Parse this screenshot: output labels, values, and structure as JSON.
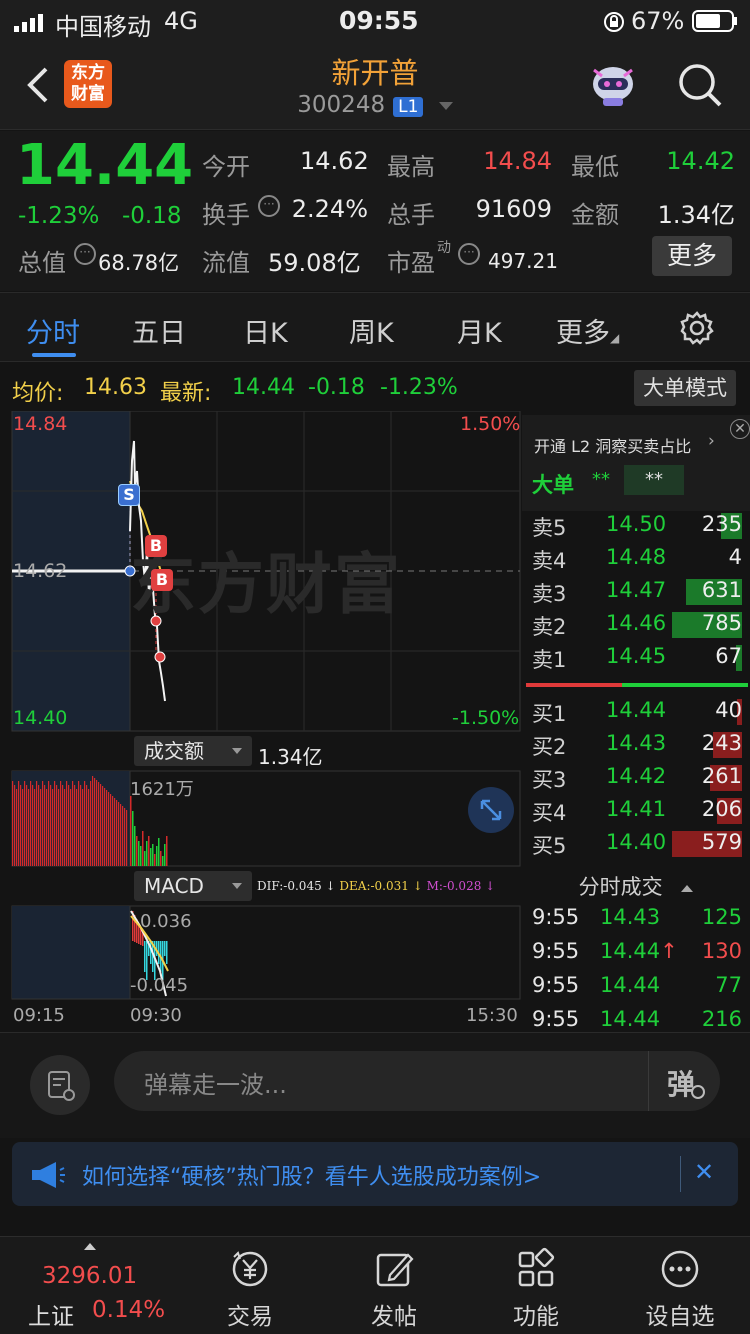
{
  "status_bar": {
    "carrier": "中国移动",
    "network": "4G",
    "time": "09:55",
    "battery": "67%"
  },
  "header": {
    "title": "新开普",
    "code": "300248",
    "level_badge": "L1",
    "logo_line1": "东方",
    "logo_line2": "财富"
  },
  "quote": {
    "price": "14.44",
    "change_pct": "-1.23%",
    "change": "-0.18",
    "open_label": "今开",
    "open": "14.62",
    "high_label": "最高",
    "high": "14.84",
    "low_label": "最低",
    "low": "14.42",
    "turnover_label": "换手",
    "turnover": "2.24%",
    "volume_label": "总手",
    "volume": "91609",
    "amount_label": "金额",
    "amount": "1.34亿",
    "mcap_label": "总值",
    "mcap": "68.78亿",
    "float_label": "流值",
    "float": "59.08亿",
    "pe_label": "市盈",
    "pe_sup": "动",
    "pe": "497.21",
    "more_button": "更多"
  },
  "tabs": [
    {
      "label": "分时",
      "active": true
    },
    {
      "label": "五日"
    },
    {
      "label": "日K"
    },
    {
      "label": "周K"
    },
    {
      "label": "月K"
    },
    {
      "label": "更多"
    }
  ],
  "info": {
    "avg_label": "均价:",
    "avg": "14.63",
    "latest_label": "最新:",
    "latest": "14.44",
    "latest_chg": "-0.18",
    "latest_pct": "-1.23%",
    "big_order_button": "大单模式"
  },
  "chart": {
    "price_top": "14.84",
    "price_mid": "14.62",
    "price_bottom": "14.40",
    "pct_top": "1.50%",
    "pct_bottom": "-1.50%",
    "watermark": "东方财富",
    "volume_selector": "成交额",
    "volume_total": "1.34亿",
    "volume_max": "1621万",
    "macd_selector": "MACD",
    "dif": "DIF:-0.045",
    "dea": "DEA:-0.031",
    "m": "M:-0.028",
    "macd_top": "0.036",
    "macd_bottom": "-0.045",
    "time_start": "09:15",
    "time_open": "09:30",
    "time_end": "15:30",
    "markers": [
      "S",
      "B",
      "B"
    ]
  },
  "side_panel": {
    "promo": "开通 L2 洞察买卖占比",
    "big_order_label": "大单",
    "big_order_val1": "**",
    "big_order_val2": "**",
    "asks": [
      {
        "label": "卖5",
        "price": "14.50",
        "vol": "235",
        "ratio": 0.3
      },
      {
        "label": "卖4",
        "price": "14.48",
        "vol": "4",
        "ratio": 0.0
      },
      {
        "label": "卖3",
        "price": "14.47",
        "vol": "631",
        "ratio": 0.8
      },
      {
        "label": "卖2",
        "price": "14.46",
        "vol": "785",
        "ratio": 1.0
      },
      {
        "label": "卖1",
        "price": "14.45",
        "vol": "67",
        "ratio": 0.09
      }
    ],
    "bids": [
      {
        "label": "买1",
        "price": "14.44",
        "vol": "40",
        "ratio": 0.07
      },
      {
        "label": "买2",
        "price": "14.43",
        "vol": "243",
        "ratio": 0.42
      },
      {
        "label": "买3",
        "price": "14.42",
        "vol": "261",
        "ratio": 0.45
      },
      {
        "label": "买4",
        "price": "14.41",
        "vol": "206",
        "ratio": 0.36
      },
      {
        "label": "买5",
        "price": "14.40",
        "vol": "579",
        "ratio": 1.0
      }
    ],
    "trades_title": "分时成交",
    "trades": [
      {
        "time": "9:55",
        "price": "14.43",
        "vol": "125",
        "vol_color": "#1fcf3a",
        "arrow": ""
      },
      {
        "time": "9:55",
        "price": "14.44",
        "vol": "130",
        "vol_color": "#f24d4d",
        "arrow": "↑"
      },
      {
        "time": "9:55",
        "price": "14.44",
        "vol": "77",
        "vol_color": "#1fcf3a",
        "arrow": ""
      },
      {
        "time": "9:55",
        "price": "14.44",
        "vol": "216",
        "vol_color": "#1fcf3a",
        "arrow": ""
      }
    ]
  },
  "danmu": {
    "placeholder": "弹幕走一波...",
    "send_label": "弹"
  },
  "banner": {
    "text": "如何选择“硬核”热门股？看牛人选股成功案例>"
  },
  "bottom_nav": {
    "index_value": "3296.01",
    "index_name": "上证",
    "index_pct": "0.14%",
    "items": [
      "交易",
      "发帖",
      "功能",
      "设自选"
    ]
  }
}
